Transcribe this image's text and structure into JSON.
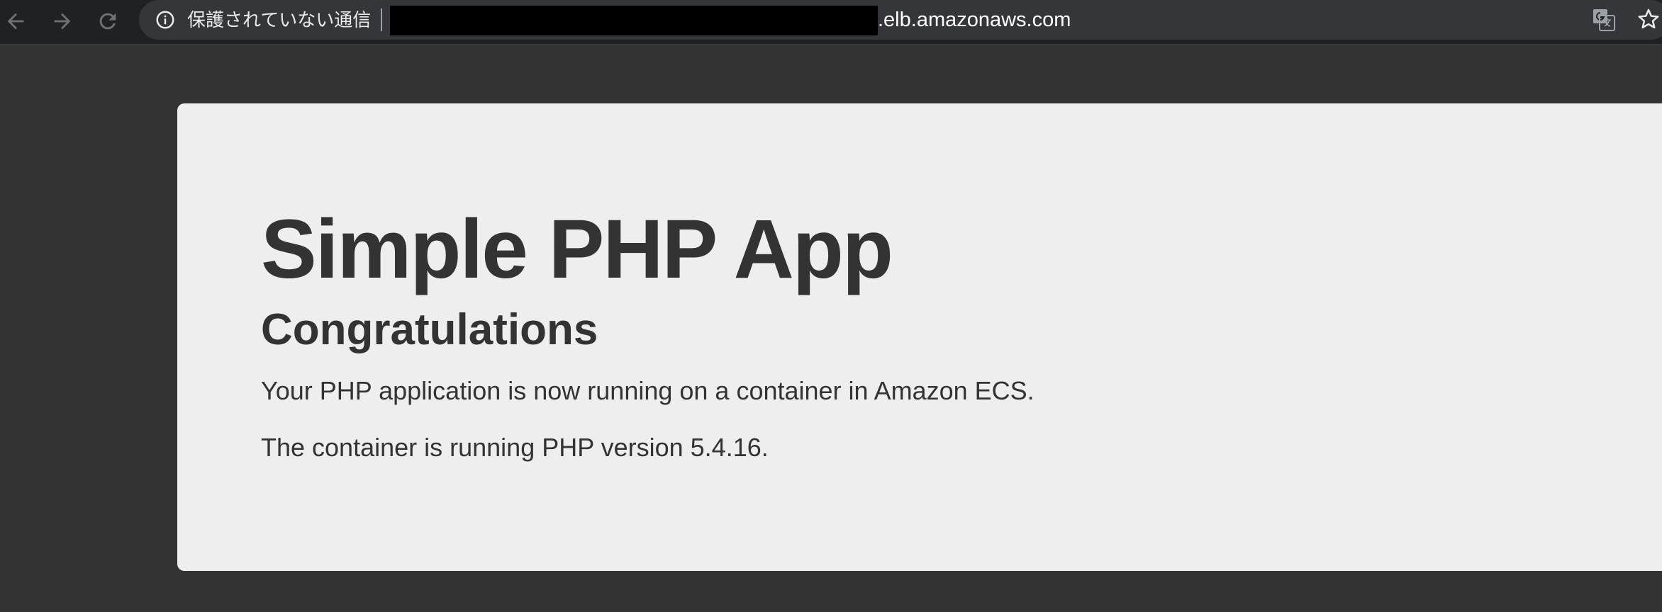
{
  "browser": {
    "security_text": "保護されていない通信",
    "url_suffix": ".elb.amazonaws.com",
    "icons": {
      "back": "arrow-left-icon",
      "forward": "arrow-right-icon",
      "reload": "reload-icon",
      "info": "info-icon",
      "translate": "translate-icon",
      "bookmark": "star-icon"
    }
  },
  "page": {
    "title": "Simple PHP App",
    "subtitle": "Congratulations",
    "message": "Your PHP application is now running on a container in Amazon ECS.",
    "version_text": "The container is running PHP version 5.4.16."
  },
  "colors": {
    "page_background": "#333333",
    "card_background": "#eeeeee",
    "text": "#333333",
    "toolbar": "#202124",
    "omnibox": "#35363a"
  }
}
